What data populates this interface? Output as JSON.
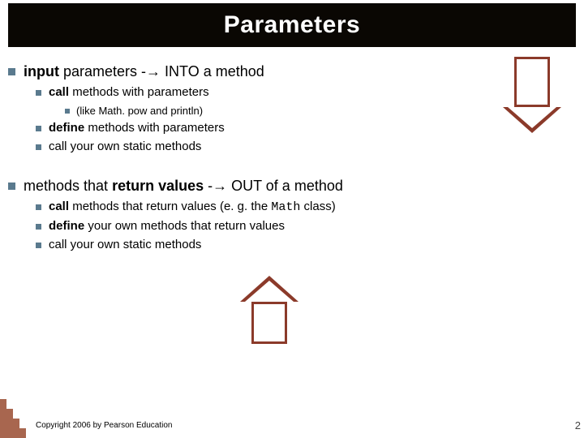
{
  "title": "Parameters",
  "point1": {
    "pre": "input",
    "mid": " parameters -",
    "arrow": "→",
    "post": " INTO a method"
  },
  "p1a_bold": "call",
  "p1a_rest": " methods with parameters",
  "p1a_sub": "(like Math. pow and println)",
  "p1b_bold": "define",
  "p1b_rest": " methods with parameters",
  "p1c": "call your own static methods",
  "point2": {
    "pre": "methods that ",
    "bold": "return values",
    "mid": " -",
    "arrow": "→",
    "post": " OUT of a method"
  },
  "p2a_bold": "call",
  "p2a_rest1": " methods that return values (e. g. the ",
  "p2a_mono": "Math",
  "p2a_rest2": " class)",
  "p2b_bold": "define",
  "p2b_rest": " your own methods that return values",
  "p2c": "call your own static methods",
  "copyright": "Copyright 2006 by Pearson Education",
  "page": "2"
}
